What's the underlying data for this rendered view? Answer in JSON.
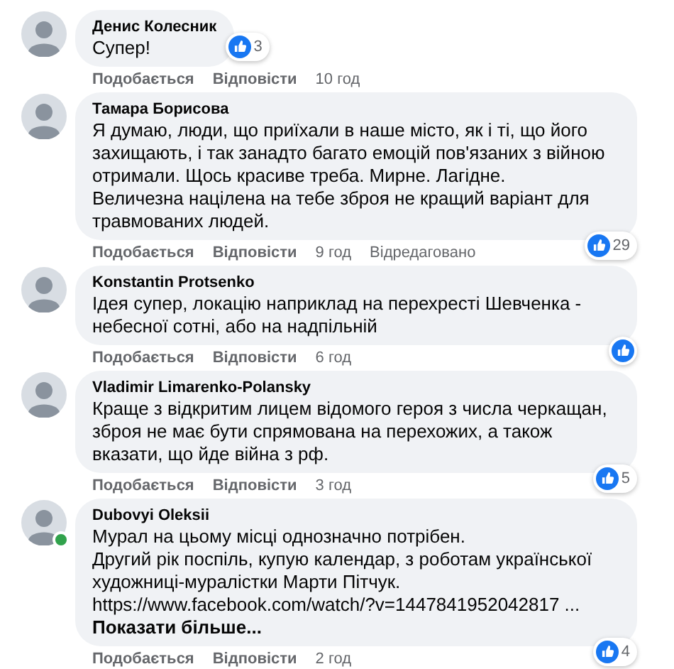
{
  "comments": [
    {
      "author": "Денис Колесник",
      "online": false,
      "paragraphs": [
        {
          "kind": "text",
          "text": "Супер!"
        }
      ],
      "reactions": {
        "like": true,
        "count": "3"
      },
      "actions": {
        "like": "Подобається",
        "reply": "Відповісти",
        "time": "10 год"
      }
    },
    {
      "author": "Тамара Борисова",
      "online": false,
      "paragraphs": [
        {
          "kind": "text",
          "text": "Я думаю, люди, що приїхали в наше місто, як і ті, що його захищають, і так занадто багато емоцій пов'язаних з війною отримали. Щось красиве треба. Мирне. Лагідне."
        },
        {
          "kind": "text",
          "text": "Величезна націлена на тебе зброя не кращий варіант для травмованих людей."
        }
      ],
      "reactions": {
        "like": true,
        "count": "29"
      },
      "actions": {
        "like": "Подобається",
        "reply": "Відповісти",
        "time": "9 год",
        "edited": "Відредаговано"
      }
    },
    {
      "author": "Konstantin Protsenko",
      "online": false,
      "paragraphs": [
        {
          "kind": "text",
          "text": "Ідея супер, локацію наприклад на перехресті Шевченка - небесної сотні, або на надпільній"
        }
      ],
      "reactions": {
        "like": true
      },
      "actions": {
        "like": "Подобається",
        "reply": "Відповісти",
        "time": "6 год"
      }
    },
    {
      "author": "Vladimir Limarenko-Polansky",
      "online": false,
      "paragraphs": [
        {
          "kind": "text",
          "text": "Краще з відкритим лицем відомого героя з числа черкащан, зброя не має бути спрямована на перехожих, а також вказати, що йде війна з рф."
        }
      ],
      "reactions": {
        "like": true,
        "count": "5"
      },
      "actions": {
        "like": "Подобається",
        "reply": "Відповісти",
        "time": "3 год"
      }
    },
    {
      "author": "Dubovyi Oleksii",
      "online": true,
      "paragraphs": [
        {
          "kind": "text",
          "text": "Мурал на цьому місці однозначно потрібен."
        },
        {
          "kind": "text",
          "text": "Другий рік поспіль, купую календар, з роботам української художниці-муралістки Марти Пітчук."
        },
        {
          "kind": "link",
          "text": "https://www.facebook.com/watch/?v=1447841952042817 ..."
        },
        {
          "kind": "see_more",
          "text": "Показати більше..."
        }
      ],
      "reactions": {
        "like": true,
        "count": "4"
      },
      "actions": {
        "like": "Подобається",
        "reply": "Відповісти",
        "time": "2 год"
      }
    }
  ]
}
